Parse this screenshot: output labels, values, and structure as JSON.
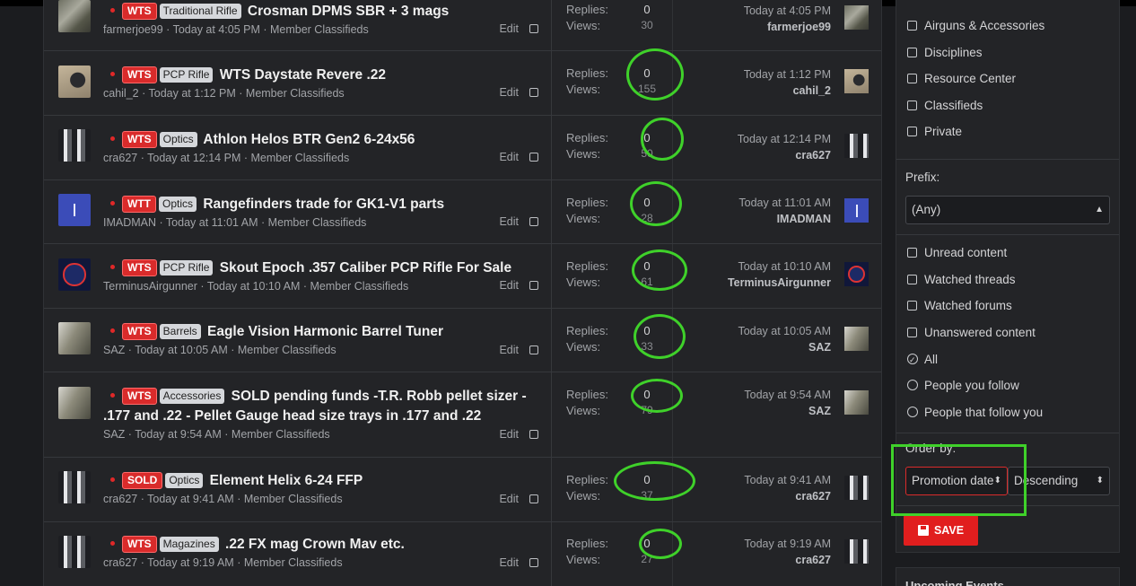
{
  "threads": [
    {
      "status": "WTS",
      "prefix": "Traditional Rifle",
      "title": "Crosman DPMS SBR + 3 mags",
      "author": "farmerjoe99",
      "time": "Today at 4:05 PM",
      "forum": "Member Classifieds",
      "edit": "Edit",
      "replies_label": "Replies:",
      "replies": "0",
      "views_label": "Views:",
      "views": "30",
      "last_time": "Today at 4:05 PM",
      "last_user": "farmerjoe99"
    },
    {
      "status": "WTS",
      "prefix": "PCP Rifle",
      "title": "WTS Daystate Revere .22",
      "author": "cahil_2",
      "time": "Today at 1:12 PM",
      "forum": "Member Classifieds",
      "edit": "Edit",
      "replies_label": "Replies:",
      "replies": "0",
      "views_label": "Views:",
      "views": "155",
      "last_time": "Today at 1:12 PM",
      "last_user": "cahil_2"
    },
    {
      "status": "WTS",
      "prefix": "Optics",
      "title": "Athlon Helos BTR Gen2 6-24x56",
      "author": "cra627",
      "time": "Today at 12:14 PM",
      "forum": "Member Classifieds",
      "edit": "Edit",
      "replies_label": "Replies:",
      "replies": "0",
      "views_label": "Views:",
      "views": "50",
      "last_time": "Today at 12:14 PM",
      "last_user": "cra627"
    },
    {
      "status": "WTT",
      "prefix": "Optics",
      "title": "Rangefinders trade for GK1-V1 parts",
      "author": "IMADMAN",
      "time": "Today at 11:01 AM",
      "forum": "Member Classifieds",
      "edit": "Edit",
      "replies_label": "Replies:",
      "replies": "0",
      "views_label": "Views:",
      "views": "28",
      "last_time": "Today at 11:01 AM",
      "last_user": "IMADMAN"
    },
    {
      "status": "WTS",
      "prefix": "PCP Rifle",
      "title": "Skout Epoch .357 Caliber PCP Rifle For Sale",
      "author": "TerminusAirgunner",
      "time": "Today at 10:10 AM",
      "forum": "Member Classifieds",
      "edit": "Edit",
      "replies_label": "Replies:",
      "replies": "0",
      "views_label": "Views:",
      "views": "61",
      "last_time": "Today at 10:10 AM",
      "last_user": "TerminusAirgunner"
    },
    {
      "status": "WTS",
      "prefix": "Barrels",
      "title": "Eagle Vision Harmonic Barrel Tuner",
      "author": "SAZ",
      "time": "Today at 10:05 AM",
      "forum": "Member Classifieds",
      "edit": "Edit",
      "replies_label": "Replies:",
      "replies": "0",
      "views_label": "Views:",
      "views": "33",
      "last_time": "Today at 10:05 AM",
      "last_user": "SAZ"
    },
    {
      "status": "WTS",
      "prefix": "Accessories",
      "title": "SOLD pending funds -T.R. Robb pellet sizer - .177 and .22 - Pellet Gauge head size trays in .177 and .22",
      "author": "SAZ",
      "time": "Today at 9:54 AM",
      "forum": "Member Classifieds",
      "edit": "Edit",
      "replies_label": "Replies:",
      "replies": "0",
      "views_label": "Views:",
      "views": "79",
      "last_time": "Today at 9:54 AM",
      "last_user": "SAZ"
    },
    {
      "status": "SOLD",
      "prefix": "Optics",
      "title": "Element Helix 6-24 FFP",
      "author": "cra627",
      "time": "Today at 9:41 AM",
      "forum": "Member Classifieds",
      "edit": "Edit",
      "replies_label": "Replies:",
      "replies": "0",
      "views_label": "Views:",
      "views": "37",
      "last_time": "Today at 9:41 AM",
      "last_user": "cra627"
    },
    {
      "status": "WTS",
      "prefix": "Magazines",
      "title": ".22 FX mag Crown Mav etc.",
      "author": "cra627",
      "time": "Today at 9:19 AM",
      "forum": "Member Classifieds",
      "edit": "Edit",
      "replies_label": "Replies:",
      "replies": "0",
      "views_label": "Views:",
      "views": "27",
      "last_time": "Today at 9:19 AM",
      "last_user": "cra627"
    }
  ],
  "sidebar": {
    "forums": [
      "Airguns & Accessories",
      "Disciplines",
      "Resource Center",
      "Classifieds",
      "Private"
    ],
    "prefix_label": "Prefix:",
    "prefix_value": "(Any)",
    "filters": [
      "Unread content",
      "Watched threads",
      "Watched forums",
      "Unanswered content"
    ],
    "radios": [
      "All",
      "People you follow",
      "People that follow you"
    ],
    "order_label": "Order by:",
    "order_value": "Promotion date",
    "direction_value": "Descending",
    "save_label": "SAVE",
    "events_label": "Upcoming Events"
  },
  "colors": {
    "accent": "#d92b2b",
    "highlight": "#3fd12a",
    "background": "#1b1c1f",
    "panel": "#232427"
  }
}
